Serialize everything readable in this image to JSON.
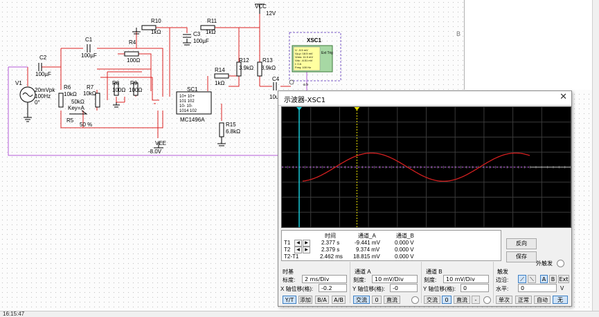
{
  "schematic": {
    "vcc_label": "VCC",
    "vcc_value": "12V",
    "vee_label": "VEE",
    "vee_value": "-8.0V",
    "ic_label": "SC1",
    "ic_part": "MC1496A",
    "ic_pins_left": [
      "10+ 10+",
      "101 102",
      "10- 10-",
      "1014 102"
    ],
    "xsc_label": "XSC1",
    "xsc_ext": "Ext Trig",
    "xsc_probe_lines": [
      "V: -9.5 mV",
      "Vp-p: 18.5 mV",
      "Vrms: 11.5 mV",
      "Vdc: -6.51 mV",
      "I: 0 A",
      "Freq: 100 Hz"
    ],
    "xsc_gnd": "a  b",
    "components": [
      {
        "ref": "R10",
        "value": "1kΩ"
      },
      {
        "ref": "R11",
        "value": "1kΩ"
      },
      {
        "ref": "C3",
        "value": "100µF"
      },
      {
        "ref": "C1",
        "value": "100µF"
      },
      {
        "ref": "R4",
        "value": "100Ω"
      },
      {
        "ref": "C2",
        "value": "100µF"
      },
      {
        "ref": "R12",
        "value": "3.9kΩ"
      },
      {
        "ref": "R13",
        "value": "3.9kΩ"
      },
      {
        "ref": "R14",
        "value": "1kΩ"
      },
      {
        "ref": "C4",
        "value": "10u"
      },
      {
        "ref": "R6",
        "value": "10kΩ"
      },
      {
        "ref": "R7",
        "value": "10kΩ"
      },
      {
        "ref": "R8",
        "value": "100Ω"
      },
      {
        "ref": "R9",
        "value": "100Ω"
      },
      {
        "ref": "R15",
        "value": "6.8kΩ"
      }
    ],
    "v1": {
      "ref": "V1",
      "line1": "20mVpk",
      "line2": "100Hz",
      "line3": "0°"
    },
    "r5": {
      "ref": "R5",
      "value": "50kΩ",
      "key": "Key=A",
      "percent": "50 %"
    }
  },
  "right_panel": {
    "letter": "B"
  },
  "status": {
    "time": "16:15:47"
  },
  "oscilloscope": {
    "title": "示波器-XSC1",
    "colors": {
      "channel_a": "#d42020",
      "cursor1": "#19c9d6",
      "cursor2": "#e8e000",
      "channel_b_trace": "#b45ad8",
      "grid": "#3a3a3a",
      "screen_bg": "#000000"
    },
    "signal": {
      "channel_a_amplitude_mv": 9.4,
      "period_ms": 10,
      "time_per_div_ms": 2,
      "mv_per_div": 10,
      "position_t1_div": 0.6,
      "position_t2_div": 2.6
    },
    "readout": {
      "headers": [
        "时间",
        "通道_A",
        "通道_B"
      ],
      "rows": [
        {
          "label": "T1",
          "time": "2.377 s",
          "a": "-9.441 mV",
          "b": "0.000 V"
        },
        {
          "label": "T2",
          "time": "2.379 s",
          "a": "9.374 mV",
          "b": "0.000 V"
        },
        {
          "label": "T2-T1",
          "time": "2.462 ms",
          "a": "18.815 mV",
          "b": "0.000 V"
        }
      ]
    },
    "buttons": {
      "invert": "反向",
      "save": "保存",
      "ext_trigger": "外触发"
    },
    "timebase": {
      "title": "时基",
      "scale_label": "标度:",
      "scale_value": "2 ms/Div",
      "xpos_label": "X 轴位移(格):",
      "xpos_value": "-0.2",
      "modes": [
        "Y/T",
        "添加",
        "B/A",
        "A/B"
      ]
    },
    "channel_a": {
      "title": "通道 A",
      "scale_label": "刻度:",
      "scale_value": "10 mV/Div",
      "ypos_label": "Y 轴位移(格):",
      "ypos_value": "-0",
      "coupling": [
        "交流",
        "0",
        "直流"
      ]
    },
    "channel_b": {
      "title": "通道 B",
      "scale_label": "刻度:",
      "scale_value": "10 mV/Div",
      "ypos_label": "Y 轴位移(格):",
      "ypos_value": "0",
      "coupling": [
        "交流",
        "0",
        "直流",
        "-"
      ]
    },
    "trigger": {
      "title": "触发",
      "edge_label": "边沿:",
      "sources": [
        "A",
        "B",
        "Ext"
      ],
      "level_label": "水平:",
      "level_value": "0",
      "level_unit": "V",
      "modes": [
        "单次",
        "正常",
        "自动",
        "无"
      ]
    }
  }
}
